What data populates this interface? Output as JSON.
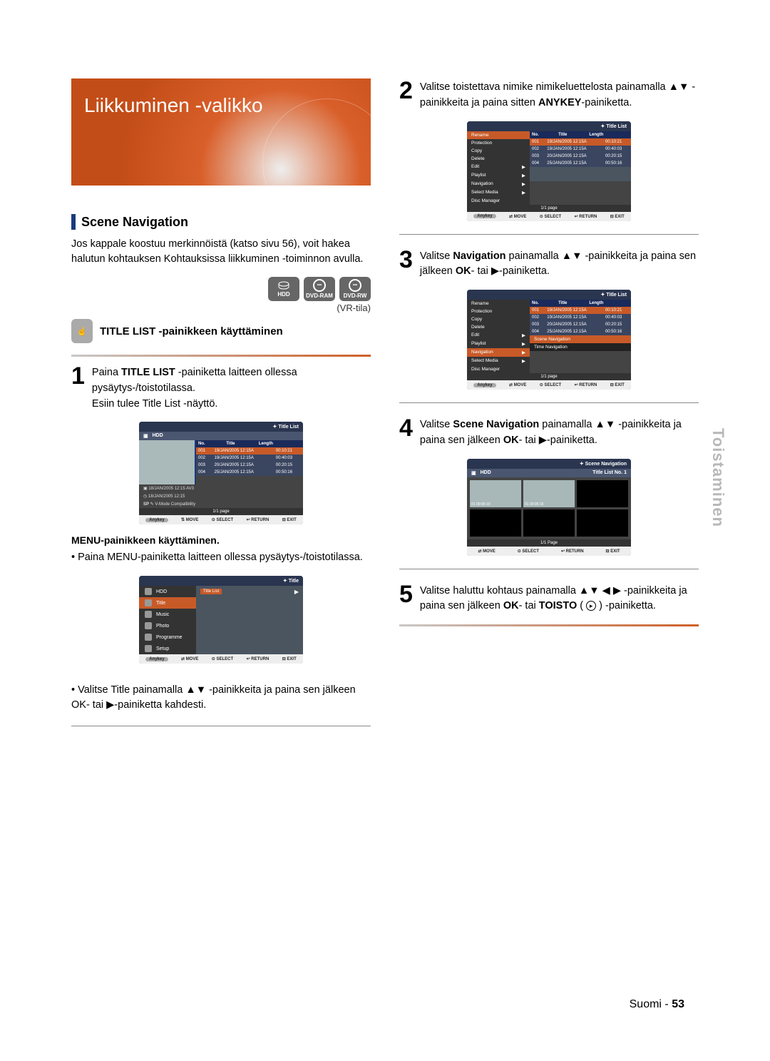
{
  "banner_title": "Liikkuminen -valikko",
  "side_tab": "Toistaminen",
  "section_heading": "Scene Navigation",
  "section_body": "Jos kappale koostuu merkinnöistä (katso sivu 56), voit hakea halutun kohtauksen Kohtauksissa liikkuminen -toiminnon avulla.",
  "media_icons": {
    "hdd": "HDD",
    "ram": "DVD-RAM",
    "rw": "DVD-RW"
  },
  "vr_mode": "(VR-tila)",
  "subhead": "TITLE LIST -painikkeen käyttäminen",
  "step1": {
    "num": "1",
    "text_a": "Paina ",
    "text_b": "TITLE LIST",
    "text_c": " -painiketta laitteen ollessa pysäytys-/toistotilassa.",
    "text2": "Esiin tulee Title List -näyttö."
  },
  "osd_common": {
    "title_list": "Title List",
    "hdd": "HDD",
    "no": "No.",
    "title_col": "Title",
    "length": "Length",
    "page": "1/1 page",
    "anykey": "Anykey",
    "move": "MOVE",
    "select": "SELECT",
    "return": "RETURN",
    "exit": "EXIT"
  },
  "titles": [
    {
      "no": "001",
      "t": "19/JAN/2005 12:15A",
      "len": "00:10:21",
      "sel": true
    },
    {
      "no": "002",
      "t": "19/JAN/2005 12:15A",
      "len": "00:40:03"
    },
    {
      "no": "003",
      "t": "20/JAN/2005 12:15A",
      "len": "00:20:15"
    },
    {
      "no": "004",
      "t": "25/JAN/2005 12:15A",
      "len": "00:50:16"
    }
  ],
  "osd1_meta": {
    "a": "18/JAN/2005 12:15 AV3",
    "b": "18/JAN/2005 12:15",
    "c": "SP",
    "d": "V-Mode Compatibility"
  },
  "menu_heading": "MENU-painikkeen käyttäminen.",
  "menu_bullet": "• Paina MENU-painiketta laitteen ollessa pysäytys-/toistotilassa.",
  "osd_title_small": "Title",
  "leftmenu": {
    "items": [
      {
        "icon": "hdd",
        "label": "HDD"
      },
      {
        "icon": "title",
        "label": "Title",
        "sel": true,
        "right": "Title List"
      },
      {
        "icon": "music",
        "label": "Music"
      },
      {
        "icon": "photo",
        "label": "Photo"
      },
      {
        "icon": "prog",
        "label": "Programme"
      },
      {
        "icon": "setup",
        "label": "Setup"
      }
    ]
  },
  "bullet_title_select": "• Valitse Title painamalla ▲▼ -painikkeita ja paina sen jälkeen OK- tai ▶-painiketta kahdesti.",
  "step2": {
    "num": "2",
    "text": "Valitse toistettava nimike nimikeluettelosta painamalla ▲▼ -painikkeita ja paina sitten ",
    "bold": "ANYKEY",
    "tail": "-painiketta."
  },
  "context_menu": [
    {
      "l": "Rename"
    },
    {
      "l": "Protection"
    },
    {
      "l": "Copy"
    },
    {
      "l": "Delete"
    },
    {
      "l": "Edit",
      "arrow": true
    },
    {
      "l": "Playlist",
      "arrow": true
    },
    {
      "l": "Navigation",
      "arrow": true
    },
    {
      "l": "Select Media",
      "arrow": true
    },
    {
      "l": "Disc Manager"
    }
  ],
  "step3": {
    "num": "3",
    "a": "Valitse ",
    "b": "Navigation",
    "c": " painamalla ▲▼ -painikkeita ja paina sen jälkeen ",
    "d": "OK",
    "e": "- tai ▶-painiketta."
  },
  "submenu": {
    "s1": "Scene Navigation",
    "s2": "Time Navigation"
  },
  "step4": {
    "num": "4",
    "a": "Valitse ",
    "b": "Scene Navigation",
    "c": " painamalla ▲▼ -painikkeita ja paina sen jälkeen ",
    "d": "OK",
    "e": "- tai ▶-painiketta."
  },
  "scene_nav": {
    "header": "Scene Navigation",
    "sub": "Title List No. 1",
    "cells": [
      {
        "l": "01  00:00:10",
        "f": true
      },
      {
        "l": "01  00:05:16",
        "f": true
      },
      {
        "l": ""
      },
      {
        "l": ""
      },
      {
        "l": ""
      },
      {
        "l": ""
      }
    ],
    "page": "1/1 Page"
  },
  "step5": {
    "num": "5",
    "a": "Valitse haluttu kohtaus painamalla ▲▼ ◀ ▶ -painikkeita ja paina sen jälkeen ",
    "b": "OK",
    "c": "- tai ",
    "d": "TOISTO",
    "e": " ( ",
    "f": " ) -painiketta."
  },
  "footer": {
    "suomi": "Suomi - ",
    "pg": "53"
  }
}
